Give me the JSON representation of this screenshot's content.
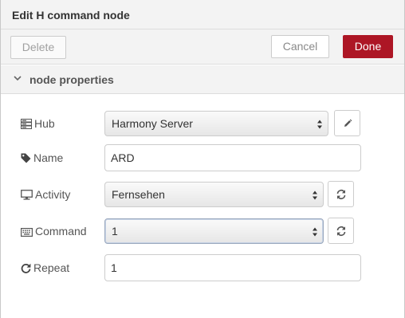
{
  "dialog": {
    "title": "Edit H command node"
  },
  "toolbar": {
    "delete_label": "Delete",
    "cancel_label": "Cancel",
    "done_label": "Done"
  },
  "section": {
    "title": "node properties"
  },
  "fields": {
    "hub": {
      "label": "Hub",
      "value": "Harmony Server",
      "icon": "server-icon",
      "action_icon": "pencil-icon"
    },
    "name": {
      "label": "Name",
      "value": "ARD",
      "icon": "tag-icon"
    },
    "activity": {
      "label": "Activity",
      "value": "Fernsehen",
      "icon": "desktop-icon",
      "action_icon": "refresh-icon"
    },
    "command": {
      "label": "Command",
      "value": "1",
      "icon": "keyboard-icon",
      "action_icon": "refresh-icon"
    },
    "repeat": {
      "label": "Repeat",
      "value": "1",
      "icon": "repeat-icon"
    }
  },
  "colors": {
    "done_button": "#ad1625",
    "panel_background": "#f3f3f3",
    "border": "#cccccc"
  }
}
